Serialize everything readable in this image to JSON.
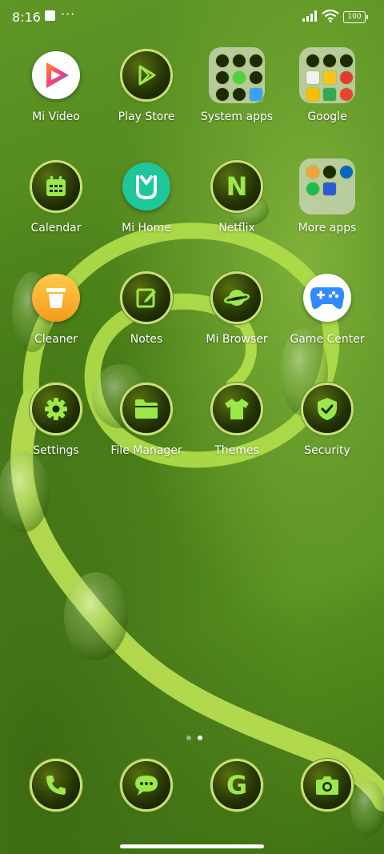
{
  "status_bar": {
    "time": "8:16",
    "dots": "···",
    "battery": "100"
  },
  "apps": [
    {
      "label": "Mi Video",
      "icon": "mi-video-icon"
    },
    {
      "label": "Play Store",
      "icon": "play-store-icon"
    },
    {
      "label": "System apps",
      "icon": "folder-icon"
    },
    {
      "label": "Google",
      "icon": "folder-icon"
    },
    {
      "label": "Calendar",
      "icon": "calendar-icon"
    },
    {
      "label": "Mi Home",
      "icon": "mi-home-icon"
    },
    {
      "label": "Netflix",
      "icon": "netflix-icon"
    },
    {
      "label": "More apps",
      "icon": "folder-icon"
    },
    {
      "label": "Cleaner",
      "icon": "cleaner-icon"
    },
    {
      "label": "Notes",
      "icon": "notes-icon"
    },
    {
      "label": "Mi Browser",
      "icon": "browser-icon"
    },
    {
      "label": "Game Center",
      "icon": "game-center-icon"
    },
    {
      "label": "Settings",
      "icon": "gear-icon"
    },
    {
      "label": "File Manager",
      "icon": "folder-icon"
    },
    {
      "label": "Themes",
      "icon": "tshirt-icon"
    },
    {
      "label": "Security",
      "icon": "shield-icon"
    }
  ],
  "dock": [
    {
      "icon": "phone-icon"
    },
    {
      "icon": "message-icon"
    },
    {
      "icon": "google-icon"
    },
    {
      "icon": "camera-icon"
    }
  ],
  "netflix_letter": "N",
  "google_letter": "G",
  "colors": {
    "accent": "#9be84a",
    "glow": "#c7e07a"
  }
}
